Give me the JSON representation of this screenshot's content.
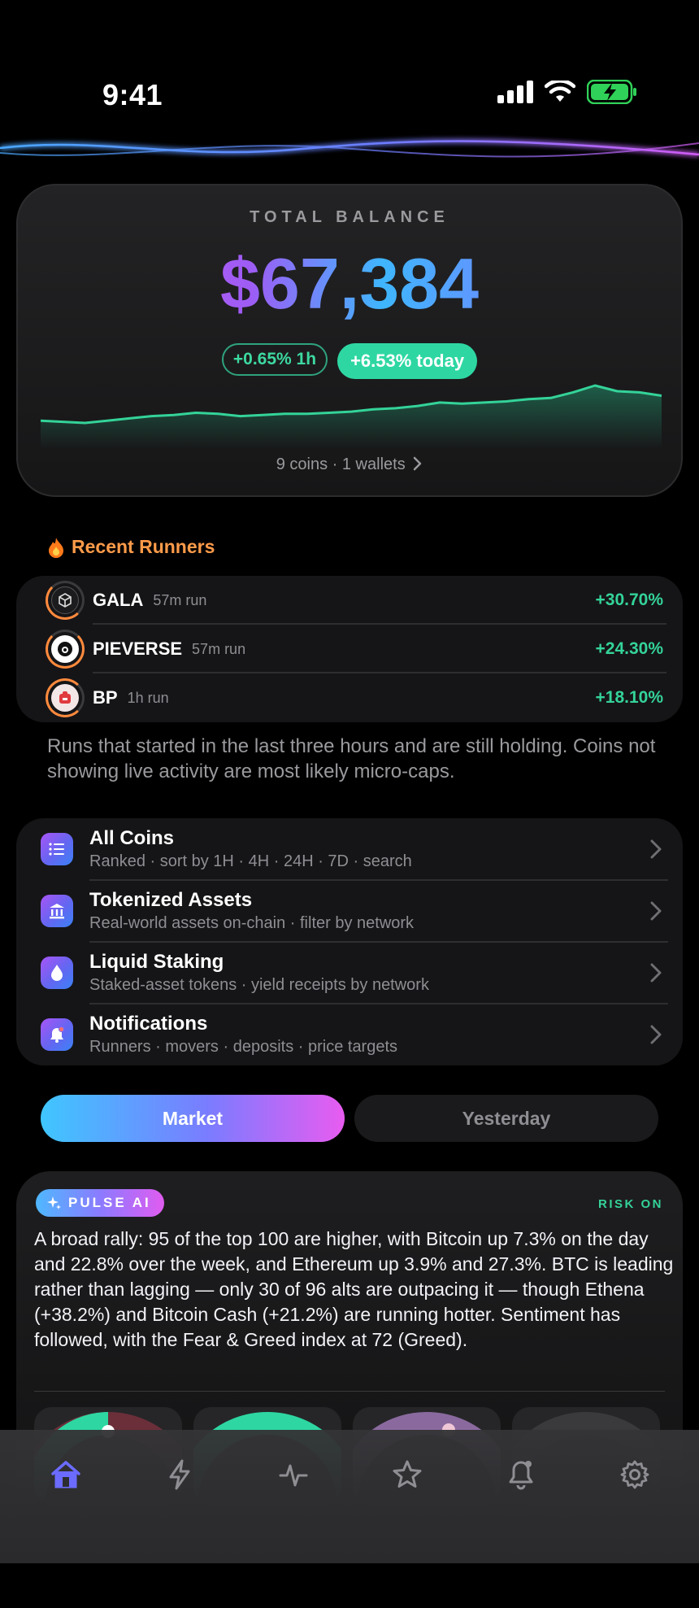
{
  "status_bar": {
    "time": "9:41"
  },
  "balance": {
    "label": "TOTAL BALANCE",
    "value": "$67,384",
    "change_1h": "+0.65% 1h",
    "change_today": "+6.53% today",
    "footer": "9 coins · 1 wallets",
    "sparkline": [
      21,
      22,
      23,
      21,
      19,
      17,
      16,
      14,
      15,
      17,
      16,
      15,
      15,
      14,
      13,
      11,
      10,
      8,
      5,
      6,
      5,
      4,
      2,
      1,
      -4,
      -10,
      -5,
      -4,
      -1
    ]
  },
  "runners": {
    "title": "Recent Runners",
    "items": [
      {
        "symbol": "GALA",
        "duration": "57m run",
        "change": "+30.70%"
      },
      {
        "symbol": "PIEVERSE",
        "duration": "57m run",
        "change": "+24.30%"
      },
      {
        "symbol": "BP",
        "duration": "1h run",
        "change": "+18.10%"
      }
    ],
    "note": "Runs that started in the last three hours and are still holding. Coins not showing live activity are most likely micro-caps."
  },
  "menu": {
    "items": [
      {
        "title": "All Coins",
        "subtitle": "Ranked · sort by 1H · 4H · 24H · 7D · search",
        "icon": "list-icon"
      },
      {
        "title": "Tokenized Assets",
        "subtitle": "Real-world assets on-chain · filter by network",
        "icon": "bank-icon"
      },
      {
        "title": "Liquid Staking",
        "subtitle": "Staked-asset tokens · yield receipts by network",
        "icon": "drop-icon"
      },
      {
        "title": "Notifications",
        "subtitle": "Runners · movers · deposits · price targets",
        "icon": "bell-icon"
      }
    ]
  },
  "segments": {
    "market": "Market",
    "yesterday": "Yesterday",
    "selected": "Market"
  },
  "pulse": {
    "badge": "PULSE AI",
    "risk": "RISK ON",
    "text": "A broad rally: 95 of the top 100 are higher, with Bitcoin up 7.3% on the day and 22.8% over the week, and Ethereum up 3.9% and 27.3%. BTC is leading rather than lagging — only 30 of 96 alts are outpacing it — though Ethena (+38.2%) and Bitcoin Cash (+21.2%) are running hotter. Sentiment has followed, with the Fear & Greed index at 72 (Greed)."
  },
  "tabbar": {
    "tabs": [
      "home-icon",
      "bolt-icon",
      "pulse-icon",
      "star-icon",
      "bell-icon",
      "gear-icon"
    ],
    "active": "home-icon"
  },
  "colors": {
    "accent_green": "#34d399",
    "accent_orange": "#ff9b4a",
    "active_tab": "#6b6cff"
  }
}
